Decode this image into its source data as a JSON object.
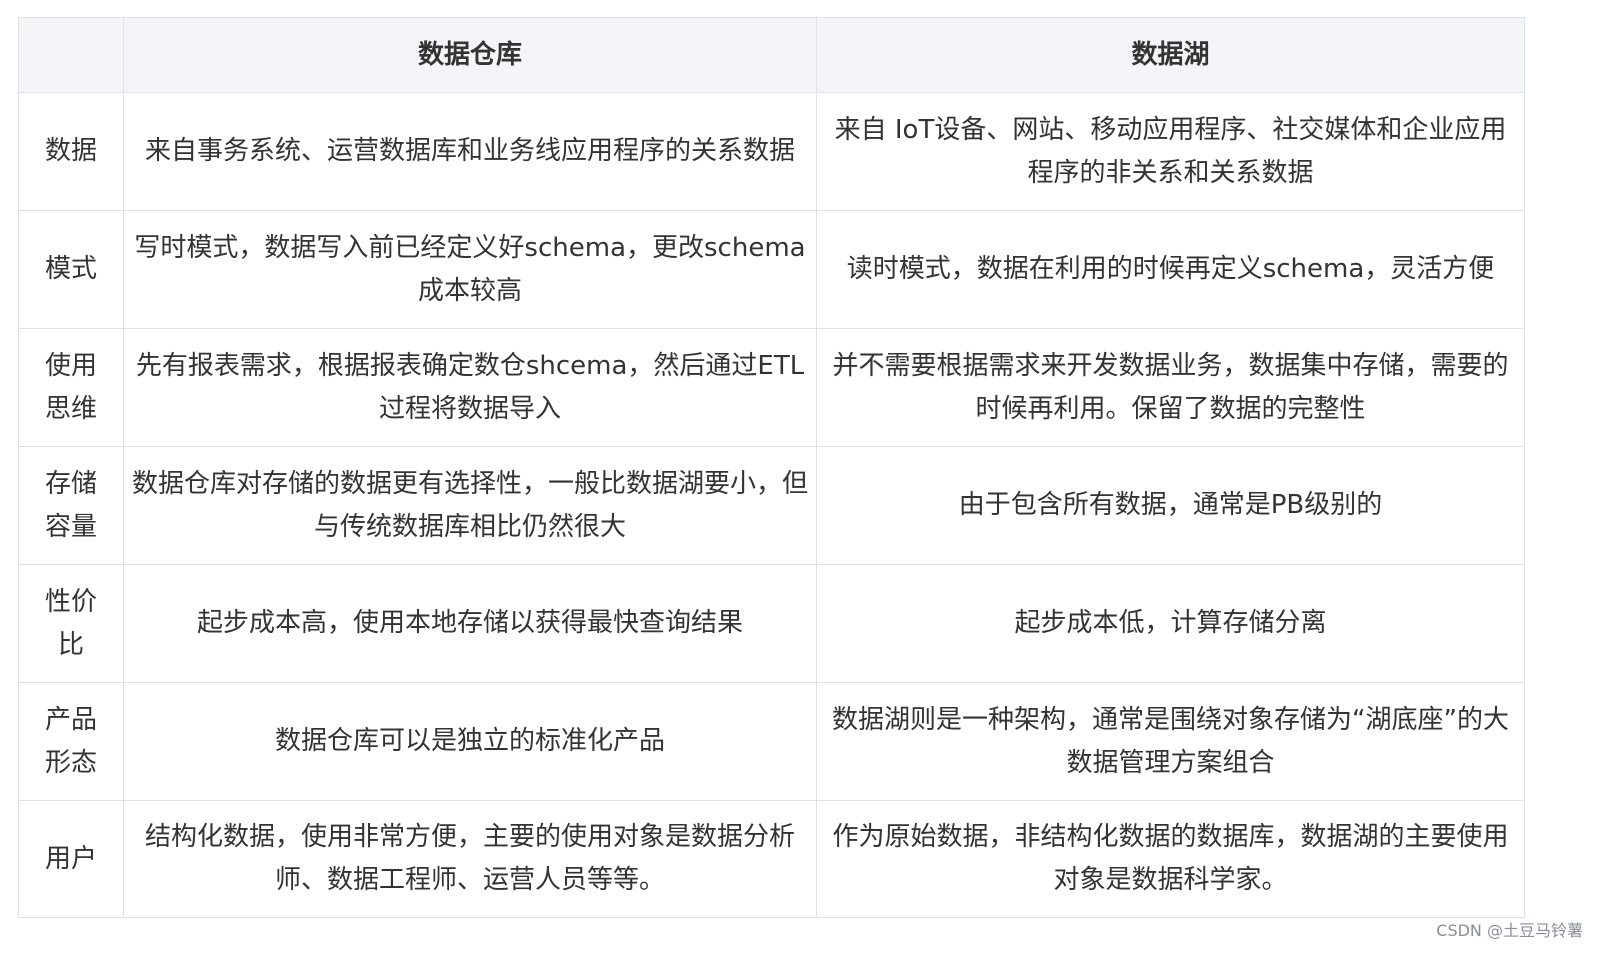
{
  "table": {
    "headers": [
      "",
      "数据仓库",
      "数据湖"
    ],
    "rows": [
      {
        "label": "数据",
        "warehouse": "来自事务系统、运营数据库和业务线应用程序的关系数据",
        "lake": "来自 IoT设备、网站、移动应用程序、社交媒体和企业应用程序的非关系和关系数据"
      },
      {
        "label": "模式",
        "warehouse": "写时模式，数据写入前已经定义好schema，更改schema成本较高",
        "lake": "读时模式，数据在利用的时候再定义schema，灵活方便"
      },
      {
        "label": "使用思维",
        "warehouse": "先有报表需求，根据报表确定数仓shcema，然后通过ETL过程将数据导入",
        "lake": "并不需要根据需求来开发数据业务，数据集中存储，需要的时候再利用。保留了数据的完整性"
      },
      {
        "label": "存储容量",
        "warehouse": "数据仓库对存储的数据更有选择性，一般比数据湖要小，但与传统数据库相比仍然很大",
        "lake": "由于包含所有数据，通常是PB级别的"
      },
      {
        "label": "性价比",
        "warehouse": "起步成本高，使用本地存储以获得最快查询结果",
        "lake": "起步成本低，计算存储分离"
      },
      {
        "label": "产品形态",
        "warehouse": "数据仓库可以是独立的标准化产品",
        "lake": "数据湖则是一种架构，通常是围绕对象存储为“湖底座”的大数据管理方案组合"
      },
      {
        "label": "用户",
        "warehouse": "结构化数据，使用非常方便，主要的使用对象是数据分析师、数据工程师、运营人员等等。",
        "lake": "作为原始数据，非结构化数据的数据库，数据湖的主要使用对象是数据科学家。"
      }
    ]
  },
  "watermark": "CSDN @土豆马铃薯"
}
